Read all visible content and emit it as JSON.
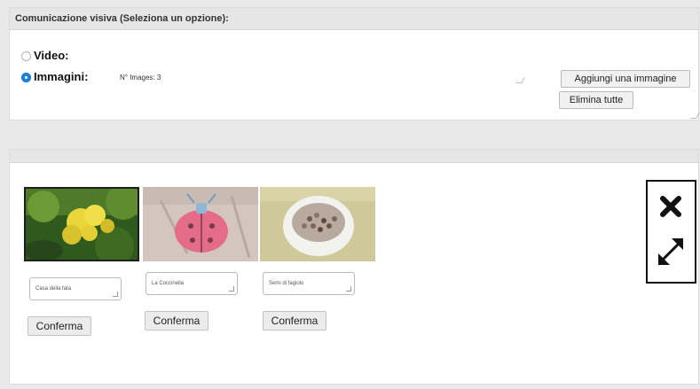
{
  "header": {
    "title": "Comunicazione visiva (Seleziona un opzione):"
  },
  "options": {
    "video_label": "Video:",
    "images_label": "Immagini:",
    "image_count": "N° Images: 3"
  },
  "buttons": {
    "add_image": "Aggiungi una immagine",
    "delete_all": "Elimina tutte"
  },
  "images": [
    {
      "caption": "Casa della fata",
      "confirm": "Conferma",
      "subject": "yellow flowers photo"
    },
    {
      "caption": "La Coccinella",
      "confirm": "Conferma",
      "subject": "ladybug craft photo"
    },
    {
      "caption": "Semi di fagiolo",
      "confirm": "Conferma",
      "subject": "beans in bowl photo"
    }
  ],
  "icons": {
    "close": "close-icon",
    "expand": "expand-icon"
  },
  "colors": {
    "radio_selected": "#1a82e2",
    "panel_header": "#e6e6e6"
  }
}
